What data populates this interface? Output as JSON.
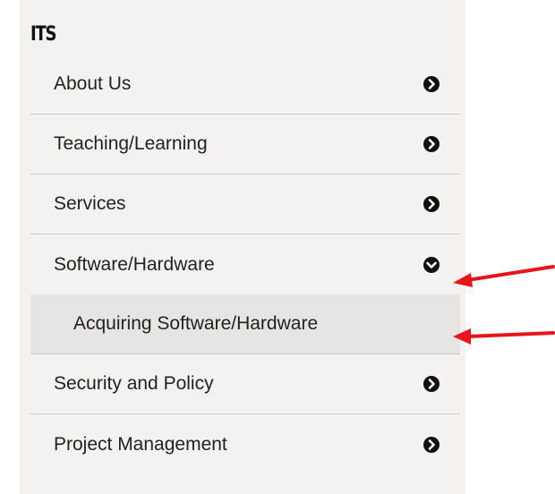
{
  "sidebar": {
    "title": "ITS",
    "items": [
      {
        "label": "About Us",
        "icon": "chevron-right-circle-icon"
      },
      {
        "label": "Teaching/Learning",
        "icon": "chevron-right-circle-icon"
      },
      {
        "label": "Services",
        "icon": "chevron-right-circle-icon"
      },
      {
        "label": "Software/Hardware",
        "icon": "chevron-down-circle-icon",
        "expanded": true
      },
      {
        "label": "Acquiring Software/Hardware",
        "submenu": true
      },
      {
        "label": "Security and Policy",
        "icon": "chevron-right-circle-icon"
      },
      {
        "label": "Project Management",
        "icon": "chevron-right-circle-icon"
      }
    ]
  },
  "annotations": {
    "arrow_color": "#e8141b"
  },
  "colors": {
    "panel_bg": "#f3f2f1",
    "submenu_bg": "#e6e5e4",
    "divider": "#c9c9c9",
    "text": "#222222"
  }
}
